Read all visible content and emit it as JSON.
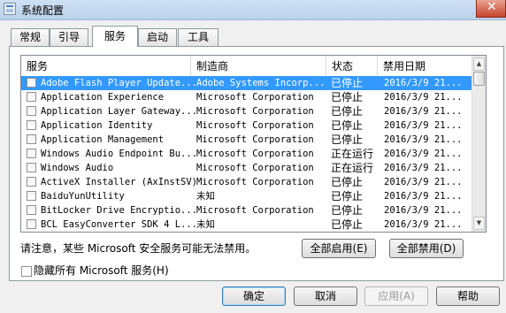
{
  "window": {
    "title": "系统配置",
    "close_glyph": "✕"
  },
  "tabs": [
    {
      "label": "常规"
    },
    {
      "label": "引导"
    },
    {
      "label": "服务"
    },
    {
      "label": "启动"
    },
    {
      "label": "工具"
    }
  ],
  "active_tab": "服务",
  "list": {
    "columns": [
      "服务",
      "制造商",
      "状态",
      "禁用日期"
    ],
    "rows": [
      {
        "service": "Adobe Flash Player Update...",
        "manufacturer": "Adobe Systems Incorp...",
        "status": "已停止",
        "date": "2016/3/9 21...",
        "checked": false,
        "selected": true
      },
      {
        "service": "Application Experience",
        "manufacturer": "Microsoft Corporation",
        "status": "已停止",
        "date": "2016/3/9 21...",
        "checked": false
      },
      {
        "service": "Application Layer Gateway...",
        "manufacturer": "Microsoft Corporation",
        "status": "已停止",
        "date": "2016/3/9 21...",
        "checked": false
      },
      {
        "service": "Application Identity",
        "manufacturer": "Microsoft Corporation",
        "status": "已停止",
        "date": "2016/3/9 21...",
        "checked": false
      },
      {
        "service": "Application Management",
        "manufacturer": "Microsoft Corporation",
        "status": "已停止",
        "date": "2016/3/9 21...",
        "checked": false
      },
      {
        "service": "Windows Audio Endpoint Bu...",
        "manufacturer": "Microsoft Corporation",
        "status": "正在运行",
        "date": "2016/3/9 21...",
        "checked": false
      },
      {
        "service": "Windows Audio",
        "manufacturer": "Microsoft Corporation",
        "status": "正在运行",
        "date": "2016/3/9 21...",
        "checked": false
      },
      {
        "service": "ActiveX Installer (AxInstSV)",
        "manufacturer": "Microsoft Corporation",
        "status": "已停止",
        "date": "2016/3/9 21...",
        "checked": false
      },
      {
        "service": "BaiduYunUtility",
        "manufacturer": "未知",
        "status": "已停止",
        "date": "2016/3/9 21...",
        "checked": false
      },
      {
        "service": "BitLocker Drive Encryptio...",
        "manufacturer": "Microsoft Corporation",
        "status": "已停止",
        "date": "2016/3/9 21...",
        "checked": false
      },
      {
        "service": "BCL EasyConverter SDK 4 L...",
        "manufacturer": "未知",
        "status": "已停止",
        "date": "2016/3/9 21...",
        "checked": false
      }
    ]
  },
  "note": "请注意，某些 Microsoft 安全服务可能无法禁用。",
  "buttons": {
    "enable_all": "全部启用(E)",
    "disable_all": "全部禁用(D)",
    "ok": "确定",
    "cancel": "取消",
    "apply": "应用(A)",
    "help": "帮助"
  },
  "hide_ms_label": "隐藏所有 Microsoft 服务(H)",
  "scroll_up": "▲",
  "scroll_down": "▼"
}
